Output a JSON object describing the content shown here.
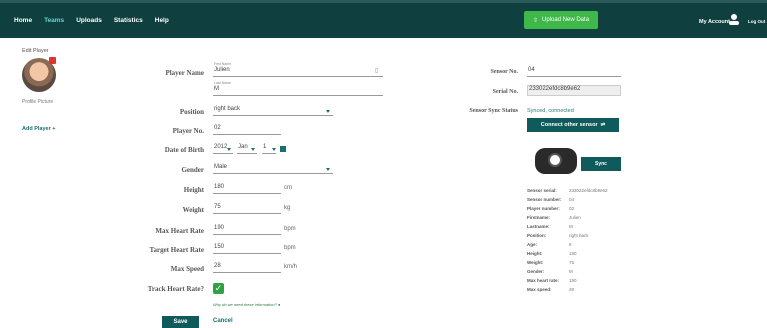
{
  "nav": {
    "items": [
      "Home",
      "Teams",
      "Uploads",
      "Statistics",
      "Help"
    ],
    "active": "Teams"
  },
  "header": {
    "upload_label": "Upload New Data",
    "account_label": "My Account",
    "logout_label": "Log Out"
  },
  "sidebar": {
    "title": "Edit Player",
    "profile_picture": "Profile Picture",
    "add_player": "Add Player +"
  },
  "form": {
    "player_name_label": "Player Name",
    "first_name_mini": "First Name",
    "first_name": "Julien",
    "last_name_mini": "Last Name",
    "last_name": "M",
    "position_label": "Position",
    "position": "right back",
    "player_no_label": "Player No.",
    "player_no": "02",
    "dob_label": "Date of Birth",
    "dob_year": "2012",
    "dob_month": "Jan",
    "dob_day": "1",
    "gender_label": "Gender",
    "gender": "Male",
    "height_label": "Height",
    "height": "180",
    "height_unit": "cm",
    "weight_label": "Weight",
    "weight": "75",
    "weight_unit": "kg",
    "max_hr_label": "Max Heart Rate",
    "max_hr": "190",
    "max_hr_unit": "bpm",
    "target_hr_label": "Target Heart Rate",
    "target_hr": "150",
    "target_hr_unit": "bpm",
    "max_speed_label": "Max Speed",
    "max_speed": "28",
    "max_speed_unit": "km/h",
    "track_hr_label": "Track Heart Rate?",
    "track_hr_checked": true,
    "why_note": "Why do we need these information?",
    "save_label": "Save",
    "cancel_label": "Cancel"
  },
  "sensor": {
    "sensor_no_label": "Sensor No.",
    "sensor_no": "04",
    "serial_no_label": "Serial No.",
    "serial_no": "233022efdc8b9e62",
    "sync_status_label": "Sensor Sync Status",
    "sync_status": "Synced, connected",
    "connect_label": "Connect other sensor",
    "sync_label": "Sync",
    "details": [
      {
        "k": "Sensor serial:",
        "v": "233022efdc8b9e62"
      },
      {
        "k": "Sensor number:",
        "v": "04"
      },
      {
        "k": "Player number:",
        "v": "02"
      },
      {
        "k": "Firstname:",
        "v": "Julien"
      },
      {
        "k": "Lastname:",
        "v": "M"
      },
      {
        "k": "Position:",
        "v": "right back"
      },
      {
        "k": "Age:",
        "v": "6"
      },
      {
        "k": "Height:",
        "v": "180"
      },
      {
        "k": "Weight:",
        "v": "75"
      },
      {
        "k": "Gender:",
        "v": "M"
      },
      {
        "k": "Max heart rate:",
        "v": "190"
      },
      {
        "k": "Max speed:",
        "v": "28"
      }
    ]
  },
  "colors": {
    "topbar": "#0f3f3f",
    "accent": "#0f5a5a",
    "upload": "#3fb84a"
  }
}
